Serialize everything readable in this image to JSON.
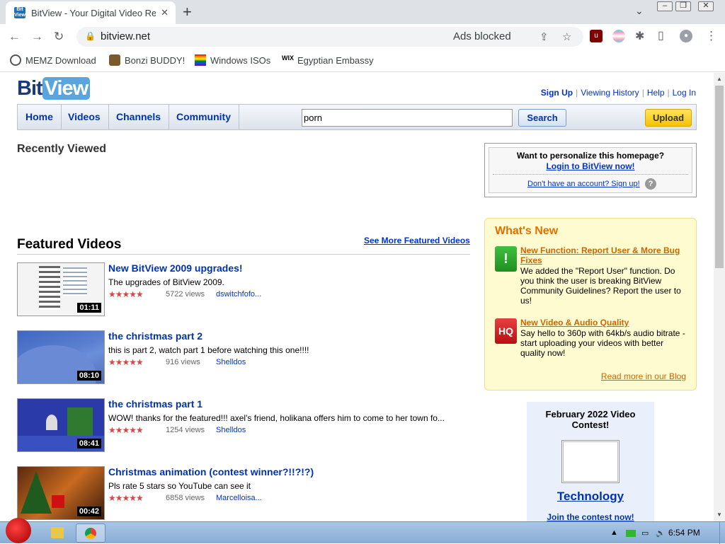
{
  "browser": {
    "tab_title": "BitView - Your Digital Video Re",
    "favicon_text": "Bit View",
    "url": "bitview.net",
    "ads_blocked": "Ads blocked",
    "bookmarks": [
      "MEMZ Download",
      "Bonzi BUDDY!",
      "Windows ISOs",
      "Egyptian Embassy"
    ]
  },
  "header": {
    "logo_bit": "Bit",
    "logo_view": "View",
    "links": [
      "Sign Up",
      "Viewing History",
      "Help",
      "Log In"
    ]
  },
  "nav": {
    "items": [
      "Home",
      "Videos",
      "Channels",
      "Community"
    ],
    "search_value": "porn",
    "search_button": "Search",
    "upload_button": "Upload"
  },
  "recently_viewed": {
    "title": "Recently Viewed"
  },
  "featured": {
    "title": "Featured Videos",
    "see_more": "See More Featured Videos",
    "videos": [
      {
        "title": "New BitView 2009 upgrades!",
        "description": "The upgrades of BitView 2009.",
        "views": "5722 views",
        "author": "dswitchfofo...",
        "duration": "01:11",
        "stars": "★★★★★"
      },
      {
        "title": "the christmas part 2",
        "description": "this is part 2, watch part 1 before watching this one!!!!",
        "views": "916 views",
        "author": "Shelldos",
        "duration": "08:10",
        "stars": "★★★★★"
      },
      {
        "title": "the christmas part 1",
        "description": "WOW! thanks for the featured!!! axel's friend, holikana offers him to come to her town fo...",
        "views": "1254 views",
        "author": "Shelldos",
        "duration": "08:41",
        "stars": "★★★★★"
      },
      {
        "title": "Christmas animation (contest winner?!!?!?)",
        "description": "Pls rate 5 stars so YouTube can see it",
        "views": "6858 views",
        "author": "Marcelloisa...",
        "duration": "00:42",
        "stars": "★★★★★"
      }
    ]
  },
  "personalize": {
    "question": "Want to personalize this homepage?",
    "login": "Login to BitView now!",
    "signup": "Don't have an account? Sign up!",
    "help": "?"
  },
  "whats_new": {
    "title": "What's New",
    "items": [
      {
        "icon_text": "!",
        "heading": "New Function: Report User & More Bug Fixes",
        "body": "We added the \"Report User\" function. Do you think the user is breaking BitView Community Guidelines? Report the user to us!"
      },
      {
        "icon_text": "HQ",
        "heading": "New Video & Audio Quality",
        "body": "Say hello to 360p with 64kb/s audio bitrate - start uploading your videos with better quality now!"
      }
    ],
    "read_more": "Read more in our Blog"
  },
  "contest": {
    "title": "February 2022 Video Contest!",
    "category": "Technology",
    "join": "Join the contest now!"
  },
  "taskbar": {
    "time": "6:54 PM"
  },
  "colors": {
    "link": "#0033cc",
    "nav_text": "#0033aa",
    "whats_new_orange": "#e07000",
    "upload_yellow": "#f5c400"
  }
}
